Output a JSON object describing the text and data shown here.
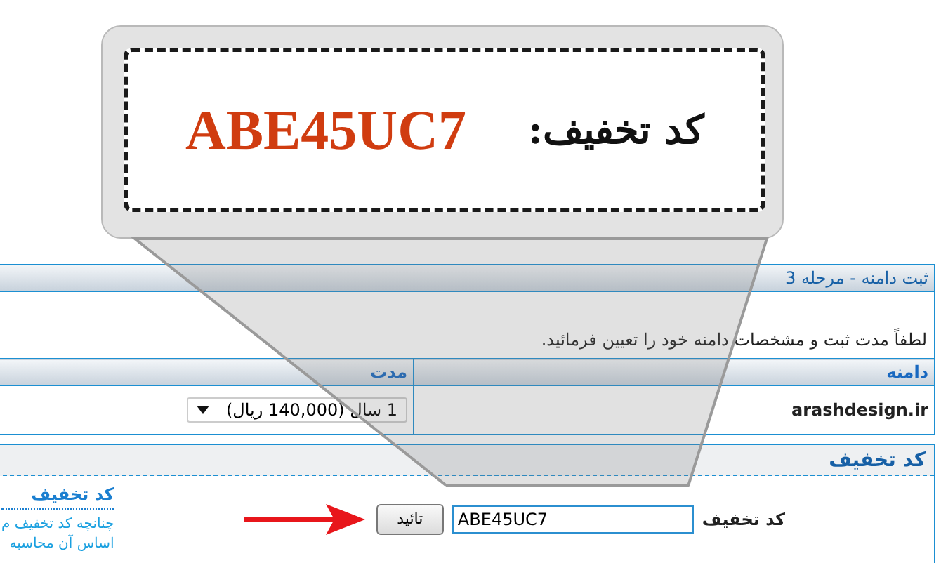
{
  "callout": {
    "label": "کد تخفیف:",
    "code": "ABE45UC7"
  },
  "panel": {
    "title": "ثبت دامنه - مرحله 3",
    "instruction": "لطفاً مدت ثبت و مشخصات دامنه خود را تعیین فرمائید.",
    "table": {
      "columns": [
        "دامنه",
        "مدت"
      ],
      "rows": [
        {
          "domain": "arashdesign.ir",
          "period": "1 سال (140,000 ریال)"
        }
      ]
    }
  },
  "discount": {
    "title": "کد تخفیف",
    "field_label": "کد تخفیف",
    "field_value": "ABE45UC7",
    "button": "تائید",
    "side_title": "کد تخفیف",
    "side_text": [
      "چنانچه کد تخفیف م",
      "اساس آن محاسبه"
    ]
  }
}
